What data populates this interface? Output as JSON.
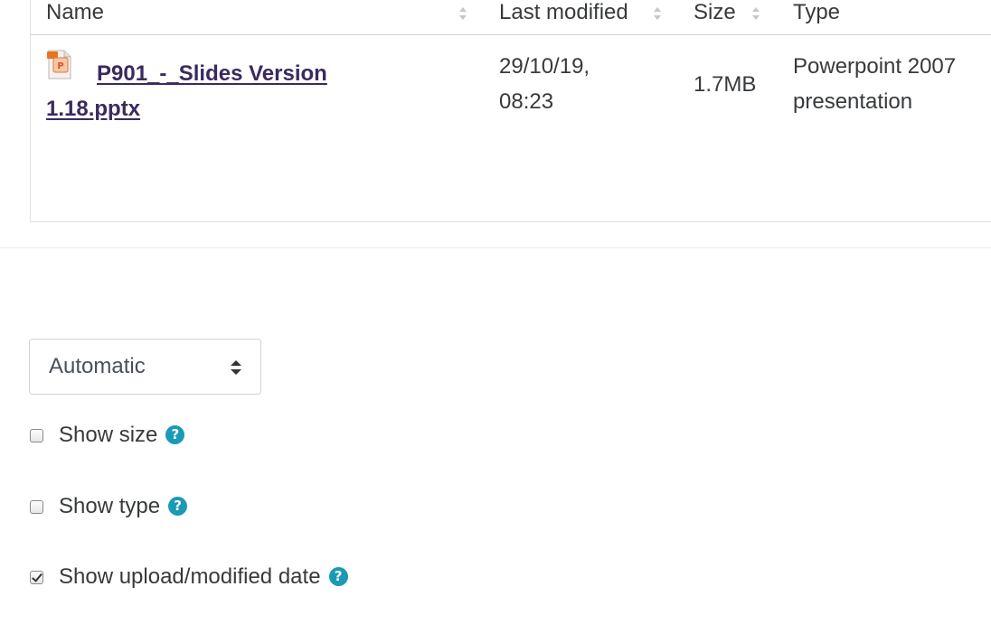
{
  "table": {
    "headers": {
      "name": "Name",
      "last_modified": "Last modified",
      "size": "Size",
      "type": "Type"
    },
    "rows": [
      {
        "file_name_line1": "P901_-_Slides Version",
        "file_name_line2": "1.18.pptx",
        "modified_line1": "29/10/19,",
        "modified_line2": "08:23",
        "size": "1.7MB",
        "type_line1": "Powerpoint 2007",
        "type_line2": "presentation",
        "icon": "powerpoint-file-icon"
      }
    ]
  },
  "display_select": {
    "value": "Automatic"
  },
  "options": {
    "show_size": {
      "label": "Show size",
      "checked": false
    },
    "show_type": {
      "label": "Show type",
      "checked": false
    },
    "show_date": {
      "label": "Show upload/modified date",
      "checked": true
    }
  },
  "help_icon_glyph": "?",
  "colors": {
    "link": "#3a2a5e",
    "help_icon": "#1a9ab5",
    "text": "#373a3c"
  }
}
